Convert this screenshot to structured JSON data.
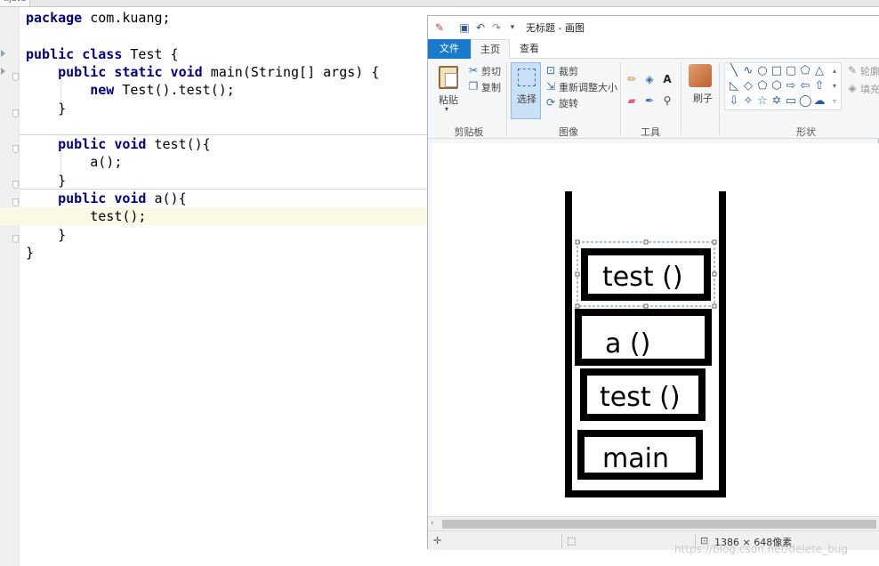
{
  "ide": {
    "tab_label": "t.java",
    "code_lines": [
      {
        "segments": [
          {
            "t": "package",
            "kw": true
          },
          {
            "t": " com.kuang;"
          }
        ]
      },
      {
        "segments": []
      },
      {
        "segments": [
          {
            "t": "public class",
            "kw": true
          },
          {
            "t": " Test {"
          }
        ]
      },
      {
        "segments": [
          {
            "t": "    "
          },
          {
            "t": "public static void",
            "kw": true
          },
          {
            "t": " main(String[] args) {"
          }
        ]
      },
      {
        "segments": [
          {
            "t": "        "
          },
          {
            "t": "new",
            "kw": true
          },
          {
            "t": " Test().test();"
          }
        ]
      },
      {
        "segments": [
          {
            "t": "    }"
          }
        ]
      },
      {
        "segments": []
      },
      {
        "segments": [
          {
            "t": "    "
          },
          {
            "t": "public void",
            "kw": true
          },
          {
            "t": " test(){"
          }
        ]
      },
      {
        "segments": [
          {
            "t": "        a();"
          }
        ]
      },
      {
        "segments": [
          {
            "t": "    }"
          }
        ]
      },
      {
        "segments": [
          {
            "t": "    "
          },
          {
            "t": "public void",
            "kw": true
          },
          {
            "t": " a(){"
          }
        ]
      },
      {
        "segments": [
          {
            "t": "        test();"
          }
        ]
      },
      {
        "segments": [
          {
            "t": "    }"
          }
        ]
      },
      {
        "segments": [
          {
            "t": "}"
          }
        ]
      }
    ]
  },
  "paint": {
    "window_title": "无标题 - 画图",
    "tabs": {
      "file": "文件",
      "home": "主页",
      "view": "查看"
    },
    "clipboard": {
      "paste": "粘贴",
      "cut": "剪切",
      "copy": "复制",
      "group": "剪贴板"
    },
    "image": {
      "select": "选择",
      "crop": "裁剪",
      "resize": "重新调整大小",
      "rotate": "旋转",
      "group": "图像"
    },
    "tools": {
      "group": "工具"
    },
    "brush": {
      "label": "刷子"
    },
    "shapes": {
      "outline": "轮廓",
      "fill": "填充",
      "group": "形状"
    },
    "status": {
      "dimensions": "1386 × 648像素"
    },
    "stack_frames": [
      "test  ()",
      "a  ()",
      "test  ()",
      "main"
    ]
  },
  "watermark": "https://blog.csdn.net/delete_bug"
}
